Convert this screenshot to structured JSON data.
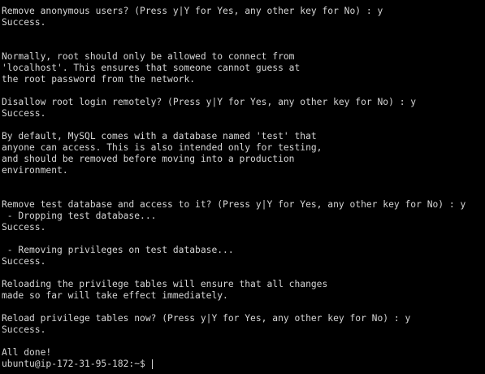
{
  "terminal": {
    "lines": [
      "Remove anonymous users? (Press y|Y for Yes, any other key for No) : y",
      "Success.",
      "",
      "",
      "Normally, root should only be allowed to connect from",
      "'localhost'. This ensures that someone cannot guess at",
      "the root password from the network.",
      "",
      "Disallow root login remotely? (Press y|Y for Yes, any other key for No) : y",
      "Success.",
      "",
      "By default, MySQL comes with a database named 'test' that",
      "anyone can access. This is also intended only for testing,",
      "and should be removed before moving into a production",
      "environment.",
      "",
      "",
      "Remove test database and access to it? (Press y|Y for Yes, any other key for No) : y",
      " - Dropping test database...",
      "Success.",
      "",
      " - Removing privileges on test database...",
      "Success.",
      "",
      "Reloading the privilege tables will ensure that all changes",
      "made so far will take effect immediately.",
      "",
      "Reload privilege tables now? (Press y|Y for Yes, any other key for No) : y",
      "Success.",
      "",
      "All done!"
    ],
    "prompt": "ubuntu@ip-172-31-95-182:~$ ",
    "colors": {
      "background": "#000000",
      "foreground": "#d6d6d6"
    }
  }
}
